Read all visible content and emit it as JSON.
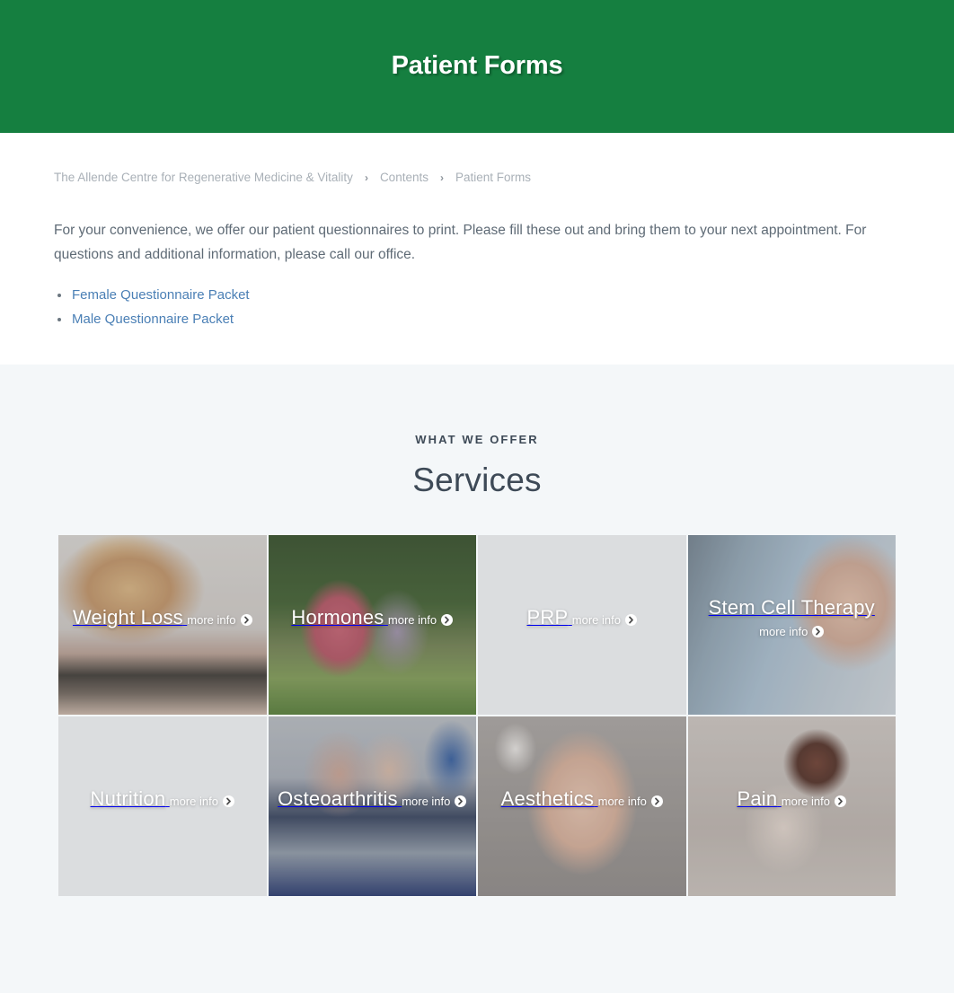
{
  "hero": {
    "title": "Patient Forms"
  },
  "breadcrumb": {
    "separator": "›",
    "items": [
      {
        "label": "The Allende Centre for Regenerative Medicine & Vitality"
      },
      {
        "label": "Contents"
      },
      {
        "label": "Patient Forms"
      }
    ]
  },
  "main": {
    "intro": "For your convenience, we offer our patient questionnaires to print. Please fill these out and bring them to your next appointment. For questions and additional information, please call our office.",
    "links": [
      {
        "label": "Female Questionnaire Packet"
      },
      {
        "label": "Male Questionnaire Packet"
      }
    ]
  },
  "services": {
    "eyebrow": "WHAT WE OFFER",
    "title": "Services",
    "more_label": "more info",
    "more_icon": "chevron-right-circle-icon",
    "cards": [
      {
        "title": "Weight Loss",
        "key": "weight-loss"
      },
      {
        "title": "Hormones",
        "key": "hormones"
      },
      {
        "title": "PRP",
        "key": "prp"
      },
      {
        "title": "Stem Cell Therapy",
        "key": "stem-cell-therapy"
      },
      {
        "title": "Nutrition",
        "key": "nutrition"
      },
      {
        "title": "Osteoarthritis",
        "key": "osteoarthritis"
      },
      {
        "title": "Aesthetics",
        "key": "aesthetics"
      },
      {
        "title": "Pain",
        "key": "pain"
      }
    ]
  },
  "colors": {
    "hero_green": "#157f40",
    "section_bg": "#f4f7f9",
    "link_blue": "#4a7fb5",
    "body_text": "#5f6b76",
    "heading": "#3e4a57",
    "breadcrumb_text": "#a9b0b7"
  }
}
